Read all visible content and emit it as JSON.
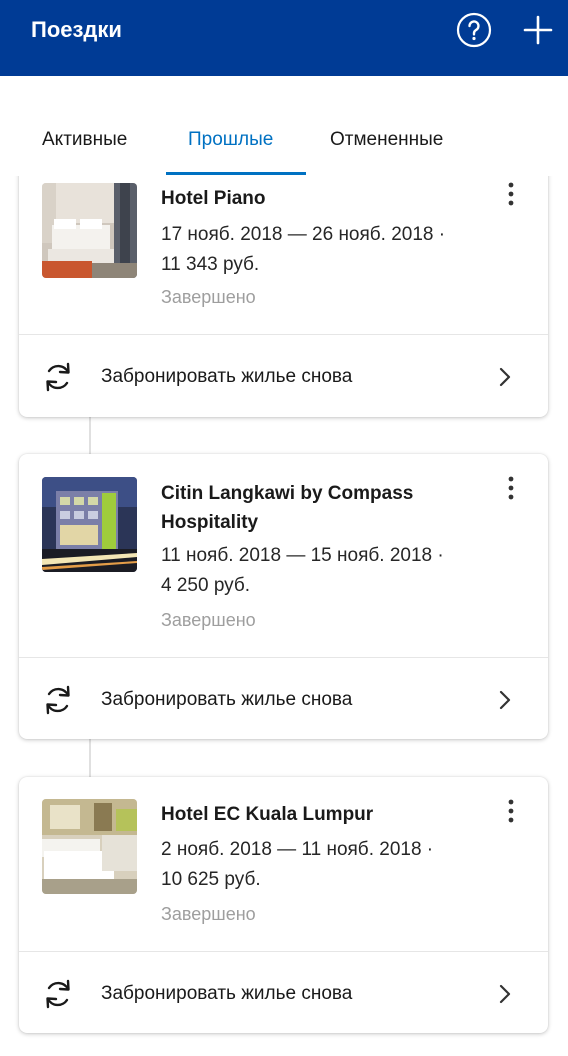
{
  "appbar": {
    "title": "Поездки",
    "help_icon": "help-circle-icon",
    "add_icon": "plus-icon",
    "background": "#003b95"
  },
  "tabs": [
    {
      "label": "Активные",
      "selected": false
    },
    {
      "label": "Прошлые",
      "selected": true
    },
    {
      "label": "Отмененные",
      "selected": false
    }
  ],
  "accent_color": "#0071c2",
  "trips": [
    {
      "hotel": "Hotel Piano",
      "dates": "17 нояб. 2018 — 26 нояб. 2018 ·",
      "price": "11 343 руб.",
      "status": "Завершено",
      "rebook_label": "Забронировать жилье снова"
    },
    {
      "hotel_line1": "Citin Langkawi by Compass",
      "hotel_line2": "Hospitality",
      "dates": "11 нояб. 2018 — 15 нояб. 2018 ·",
      "price": "4 250 руб.",
      "status": "Завершено",
      "rebook_label": "Забронировать жилье снова"
    },
    {
      "hotel": "Hotel EC Kuala Lumpur",
      "dates": "2 нояб. 2018 — 11 нояб. 2018 ·",
      "price": "10 625 руб.",
      "status": "Завершено",
      "rebook_label": "Забронировать жилье снова"
    }
  ]
}
